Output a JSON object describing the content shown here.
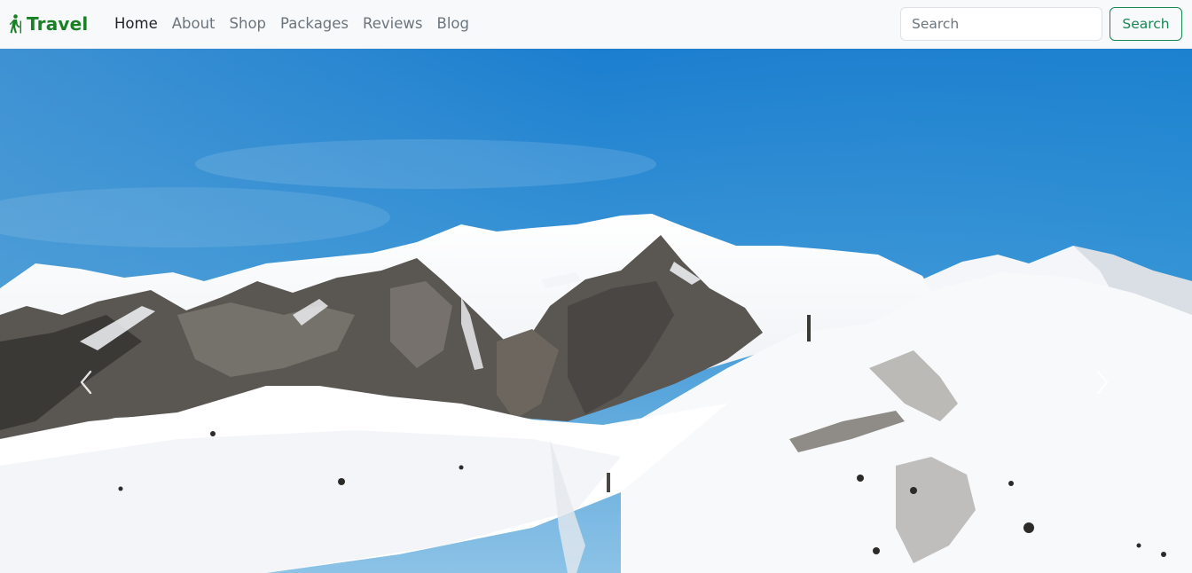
{
  "brand": {
    "name": "Travel",
    "icon": "hiking-person-icon",
    "color": "#198026"
  },
  "nav": {
    "items": [
      {
        "label": "Home",
        "active": true
      },
      {
        "label": "About",
        "active": false
      },
      {
        "label": "Shop",
        "active": false
      },
      {
        "label": "Packages",
        "active": false
      },
      {
        "label": "Reviews",
        "active": false
      },
      {
        "label": "Blog",
        "active": false
      }
    ]
  },
  "search": {
    "placeholder": "Search",
    "value": "",
    "button_label": "Search",
    "button_color": "#198754"
  },
  "hero": {
    "image": "snowy-mountain-range",
    "prev_icon": "chevron-left-icon",
    "next_icon": "chevron-right-icon"
  }
}
